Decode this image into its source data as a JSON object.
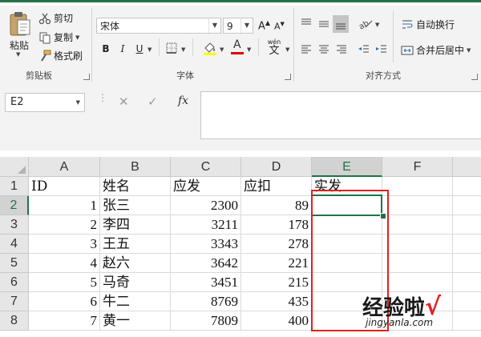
{
  "clipboard": {
    "paste_label": "粘贴",
    "cut_label": "剪切",
    "copy_label": "复制",
    "format_painter_label": "格式刷",
    "group_label": "剪贴板"
  },
  "font": {
    "font_name": "宋体",
    "font_size": "9",
    "bold": "B",
    "italic": "I",
    "underline": "U",
    "wen_label": "wén",
    "wen_char": "文",
    "group_label": "字体",
    "highlight_color": "#ffff00",
    "font_color": "#e00000"
  },
  "alignment": {
    "wrap_text_label": "自动换行",
    "merge_center_label": "合并后居中",
    "group_label": "对齐方式"
  },
  "formula_bar": {
    "name_box": "E2",
    "cancel": "✕",
    "enter": "✓",
    "fx": "fx",
    "value": ""
  },
  "sheet": {
    "columns": [
      "A",
      "B",
      "C",
      "D",
      "E",
      "F"
    ],
    "selected_column": "E",
    "selected_row": "2",
    "rows": [
      {
        "n": "1",
        "cells": [
          "ID",
          "姓名",
          "应发",
          "应扣",
          "实发",
          ""
        ]
      },
      {
        "n": "2",
        "cells": [
          "1",
          "张三",
          "2300",
          "89",
          "",
          ""
        ]
      },
      {
        "n": "3",
        "cells": [
          "2",
          "李四",
          "3211",
          "178",
          "",
          ""
        ]
      },
      {
        "n": "4",
        "cells": [
          "3",
          "王五",
          "3343",
          "278",
          "",
          ""
        ]
      },
      {
        "n": "5",
        "cells": [
          "4",
          "赵六",
          "3642",
          "221",
          "",
          ""
        ]
      },
      {
        "n": "6",
        "cells": [
          "5",
          "马奇",
          "3451",
          "215",
          "",
          ""
        ]
      },
      {
        "n": "7",
        "cells": [
          "6",
          "牛二",
          "8769",
          "435",
          "",
          ""
        ]
      },
      {
        "n": "8",
        "cells": [
          "7",
          "黄一",
          "7809",
          "400",
          "",
          ""
        ]
      }
    ]
  },
  "watermark": {
    "text": "经验啦",
    "check": "√",
    "url": "jingyanla.com"
  },
  "colors": {
    "accent": "#217346",
    "annotation": "#e02020"
  }
}
